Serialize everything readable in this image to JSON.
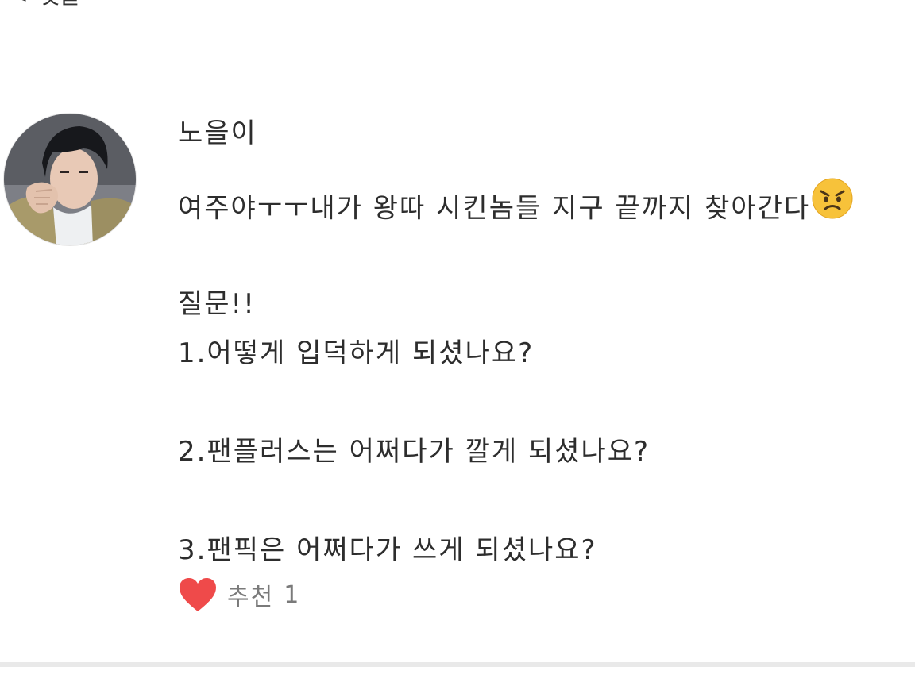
{
  "header": {
    "back_glyph": "<",
    "title": "댓글"
  },
  "comment": {
    "author": "노을이",
    "avatar": "user-avatar-photo",
    "lines": [
      "여주야ㅜㅜ내가 왕따 시킨놈들 지구 끝까지 찾아간다",
      "",
      "질문!!",
      "1.어떻게 입덕하게 되셨나요?",
      "",
      "2.팬플러스는 어쩌다가 깔게 되셨나요?",
      "",
      "3.팬픽은 어쩌다가 쓰게 되셨나요?"
    ],
    "emoji": "angry-face-icon",
    "like": {
      "label": "추천",
      "count": "1",
      "heart_color": "#ef4a4a"
    }
  },
  "colors": {
    "text": "#2d2d2d",
    "muted": "#7a7a7a",
    "divider": "#e9e9e9",
    "emoji_face": "#f7c23a"
  }
}
